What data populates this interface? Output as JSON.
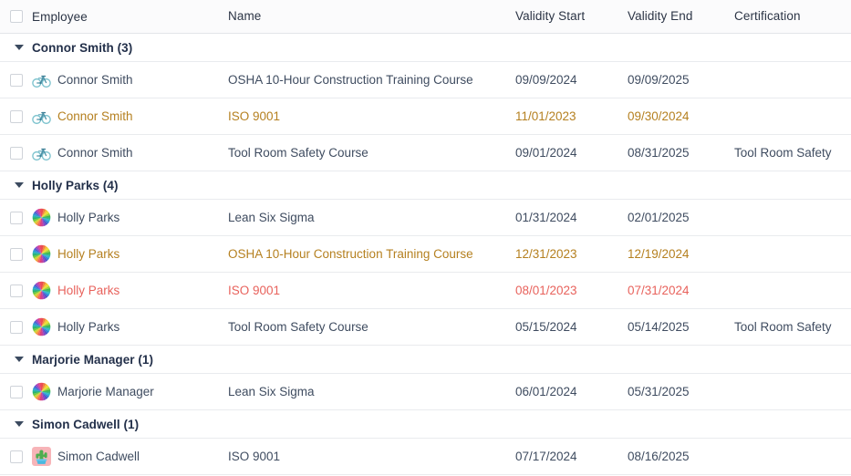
{
  "colors": {
    "ok": "#3f4c60",
    "warning": "#b58020",
    "expired": "#e8625c",
    "header_bg": "#fbfbfc",
    "row_border": "#e9ebee"
  },
  "table": {
    "columns": [
      {
        "key": "employee",
        "label": "Employee"
      },
      {
        "key": "name",
        "label": "Name"
      },
      {
        "key": "validity_start",
        "label": "Validity Start"
      },
      {
        "key": "validity_end",
        "label": "Validity End"
      },
      {
        "key": "certification",
        "label": "Certification"
      }
    ],
    "select_all": {
      "checked": false
    },
    "groups": [
      {
        "label": "Connor Smith (3)",
        "employee": "Connor Smith",
        "count": 3,
        "expanded": true,
        "avatar": "bicycle-avatar",
        "rows": [
          {
            "employee": "Connor Smith",
            "name": "OSHA 10-Hour Construction Training Course",
            "validity_start": "09/09/2024",
            "validity_end": "09/09/2025",
            "certification": "",
            "status": "ok",
            "checked": false
          },
          {
            "employee": "Connor Smith",
            "name": "ISO 9001",
            "validity_start": "11/01/2023",
            "validity_end": "09/30/2024",
            "certification": "",
            "status": "warning",
            "checked": false
          },
          {
            "employee": "Connor Smith",
            "name": "Tool Room Safety Course",
            "validity_start": "09/01/2024",
            "validity_end": "08/31/2025",
            "certification": "Tool Room Safety",
            "status": "ok",
            "checked": false
          }
        ]
      },
      {
        "label": "Holly Parks (4)",
        "employee": "Holly Parks",
        "count": 4,
        "expanded": true,
        "avatar": "pinwheel-avatar",
        "rows": [
          {
            "employee": "Holly Parks",
            "name": "Lean Six Sigma",
            "validity_start": "01/31/2024",
            "validity_end": "02/01/2025",
            "certification": "",
            "status": "ok",
            "checked": false
          },
          {
            "employee": "Holly Parks",
            "name": "OSHA 10-Hour Construction Training Course",
            "validity_start": "12/31/2023",
            "validity_end": "12/19/2024",
            "certification": "",
            "status": "warning",
            "checked": false
          },
          {
            "employee": "Holly Parks",
            "name": "ISO 9001",
            "validity_start": "08/01/2023",
            "validity_end": "07/31/2024",
            "certification": "",
            "status": "expired",
            "checked": false
          },
          {
            "employee": "Holly Parks",
            "name": "Tool Room Safety Course",
            "validity_start": "05/15/2024",
            "validity_end": "05/14/2025",
            "certification": "Tool Room Safety",
            "status": "ok",
            "checked": false
          }
        ]
      },
      {
        "label": "Marjorie Manager (1)",
        "employee": "Marjorie Manager",
        "count": 1,
        "expanded": true,
        "avatar": "pinwheel-avatar",
        "rows": [
          {
            "employee": "Marjorie Manager",
            "name": "Lean Six Sigma",
            "validity_start": "06/01/2024",
            "validity_end": "05/31/2025",
            "certification": "",
            "status": "ok",
            "checked": false
          }
        ]
      },
      {
        "label": "Simon Cadwell (1)",
        "employee": "Simon Cadwell",
        "count": 1,
        "expanded": true,
        "avatar": "cactus-avatar",
        "rows": [
          {
            "employee": "Simon Cadwell",
            "name": "ISO 9001",
            "validity_start": "07/17/2024",
            "validity_end": "08/16/2025",
            "certification": "",
            "status": "ok",
            "checked": false
          }
        ]
      }
    ]
  }
}
